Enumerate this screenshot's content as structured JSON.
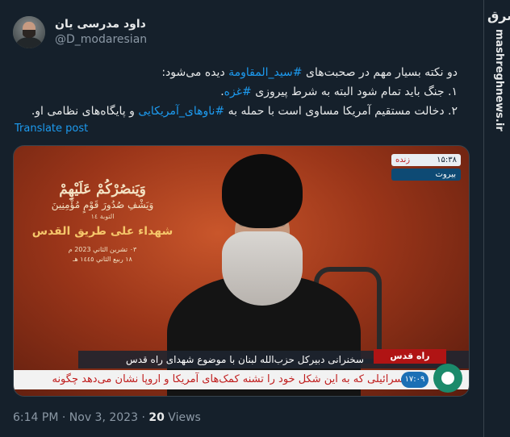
{
  "user": {
    "display_name": "داود مدرسی یان",
    "handle": "@D_modaresian"
  },
  "tweet": {
    "line1_pre": "دو نکته بسیار مهم در صحبت‌های ",
    "line1_hashtag": "#سید_المقاومة",
    "line1_post": " دیده می‌شود:",
    "line2_pre": "۱. جنگ باید تمام شود البته به شرط پیروزی ",
    "line2_hashtag": "#غزه",
    "line2_post": ".",
    "line3_pre": "۲. دخالت مستقیم آمریکا مساوی است با حمله به ",
    "line3_hashtag": "#ناوهای_آمریکایی",
    "line3_post": " و پایگاه‌های نظامی او."
  },
  "translate_label": "Translate post",
  "media": {
    "poster_line1": "وَيَنصُرْكُمْ عَلَيْهِمْ",
    "poster_line2": "وَيَشْفِ صُدُورَ قَوْمٍ مُؤْمِنِينَ",
    "poster_line3": "التوبة ١٤",
    "poster_line4": "شهداء على طريق القدس",
    "poster_line5": "٠٣ تشرين الثاني 2023 م",
    "poster_line6": "١٨ ربيع الثاني ١٤٤٥ هـ",
    "time": "۱۵:۳۸",
    "live_label": "زنده",
    "city": "بیروت",
    "program_badge": "راه قدس",
    "caption": "سخنرانی دبیرکل حزب‌الله لبنان با موضوع شهدای راه قدس",
    "ticker": "اسرائیلی که به این شکل خود را تشنه کمک‌های آمریکا و اروپا نشان می‌دهد چگونه",
    "ticker_clock": "۱۷:۰۹"
  },
  "meta": {
    "time": "6:14 PM",
    "date": "Nov 3, 2023",
    "views_count": "20",
    "views_label": "Views"
  },
  "watermark": {
    "logo": "مشرق",
    "text": "mashreghnews.ir"
  }
}
